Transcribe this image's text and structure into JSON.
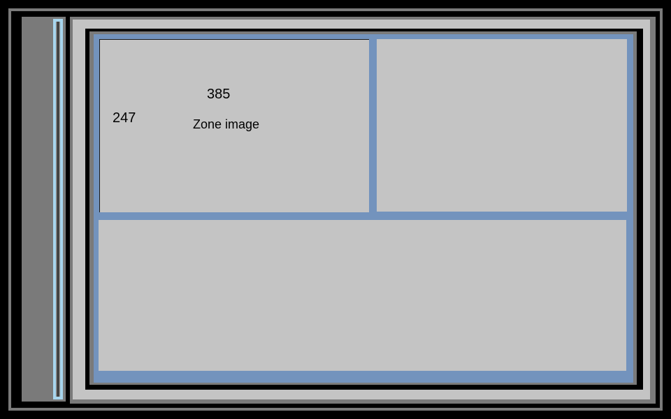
{
  "zone_image": {
    "name_label": "Zone image",
    "width_label": "385",
    "height_label": "247"
  }
}
